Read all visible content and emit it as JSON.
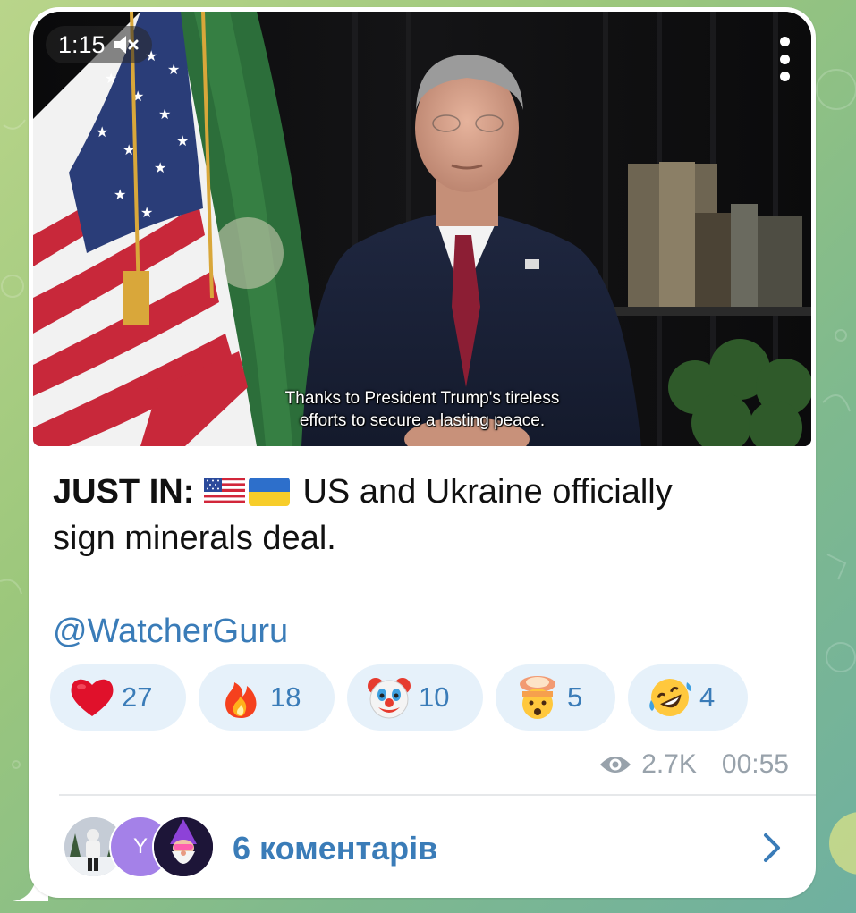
{
  "video": {
    "duration": "1:15",
    "mute_icon": "speaker-muted-icon",
    "menu_icon": "more-vertical-icon",
    "subtitle_line1": "Thanks to President Trump's tireless",
    "subtitle_line2": "efforts to secure a lasting peace."
  },
  "message": {
    "bold_prefix": "JUST IN:",
    "flags": [
      "us-flag-icon",
      "ukraine-flag-icon"
    ],
    "text_line1": " US and Ukraine officially",
    "text_line2": "sign minerals deal.",
    "mention": "@WatcherGuru"
  },
  "reactions": [
    {
      "icon": "red-heart-icon",
      "count": "27"
    },
    {
      "icon": "fire-icon",
      "count": "18"
    },
    {
      "icon": "clown-face-icon",
      "count": "10"
    },
    {
      "icon": "exploding-head-icon",
      "count": "5"
    },
    {
      "icon": "rolling-laughing-icon",
      "count": "4"
    }
  ],
  "meta": {
    "views_icon": "eye-icon",
    "views": "2.7K",
    "time": "00:55"
  },
  "comments": {
    "avatar_letter": "Y",
    "label": "6 коментарів",
    "chevron_icon": "chevron-right-icon"
  },
  "colors": {
    "accent": "#3a7cb8",
    "reaction_bg": "#e6f1fa",
    "meta_gray": "#98a2ab",
    "avatar_purple": "#a481e8"
  }
}
